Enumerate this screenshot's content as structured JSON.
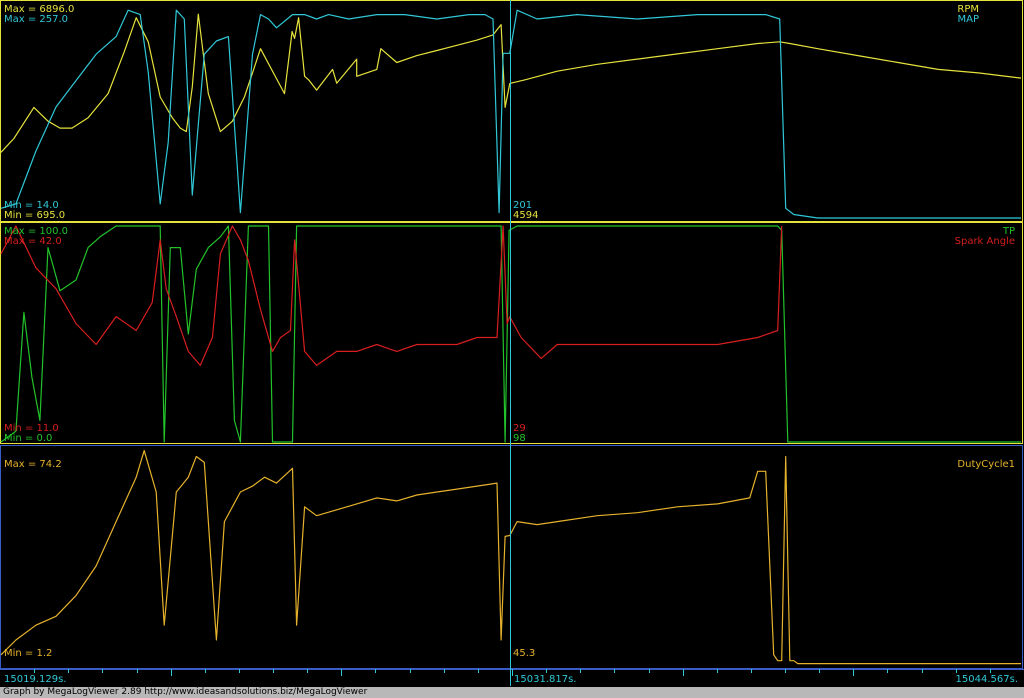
{
  "colors": {
    "rpm": "#e6e23c",
    "map": "#30c8d8",
    "tp": "#22c22a",
    "spark": "#d81e1e",
    "duty": "#e6b22c",
    "cursor": "#30c8d8"
  },
  "cursor": {
    "time": "15031.817s."
  },
  "time_axis": {
    "start": "15019.129s.",
    "end": "15044.567s."
  },
  "footer": {
    "text": "Graph by MegaLogViewer 2.89 http://www.ideasandsolutions.biz/MegaLogViewer"
  },
  "panels": {
    "p1": {
      "names": [
        "RPM",
        "MAP"
      ],
      "max": [
        "Max = 6896.0",
        "Max = 257.0"
      ],
      "min": [
        "Min = 14.0",
        "Min = 695.0"
      ],
      "cursor_values": [
        "201",
        "4594"
      ]
    },
    "p2": {
      "names": [
        "TP",
        "Spark Angle"
      ],
      "max": [
        "Max = 100.0",
        "Max = 42.0"
      ],
      "min": [
        "Min = 11.0",
        "Min = 0.0"
      ],
      "cursor_values": [
        "29",
        "98"
      ]
    },
    "p3": {
      "names": [
        "DutyCycle1"
      ],
      "max": [
        "Max = 74.2"
      ],
      "min": [
        "Min = 1.2"
      ],
      "cursor_values": [
        "45.3"
      ]
    }
  },
  "chart_data": [
    {
      "type": "line",
      "x_unit": "s",
      "xlim": [
        15019.129,
        15044.567
      ],
      "series": [
        {
          "name": "RPM",
          "ylim": [
            695.0,
            6896.0
          ],
          "x": [
            15019.129,
            15019.45,
            15019.95,
            15020.3,
            15020.6,
            15020.9,
            15021.3,
            15021.8,
            15022.2,
            15022.5,
            15022.8,
            15023.1,
            15023.4,
            15023.6,
            15023.75,
            15023.9,
            15024.05,
            15024.3,
            15024.6,
            15024.9,
            15025.2,
            15025.4,
            15025.6,
            15026.2,
            15026.8,
            15027.4,
            15028.0,
            15028.6,
            15026.39,
            15026.45,
            15026.55,
            15026.7,
            15027.0,
            15027.5,
            15028.0,
            15028.5,
            15029.0,
            15029.5,
            15030.0,
            15030.5,
            15031.0,
            15031.4,
            15031.6,
            15031.7,
            15031.817,
            15032.2,
            15033.0,
            15034.0,
            15035.0,
            15036.0,
            15037.0,
            15038.0,
            15038.55,
            15038.8,
            15039.5,
            15040.5,
            15041.5,
            15042.5,
            15043.5,
            15044.567
          ],
          "y": [
            2600,
            3000,
            3900,
            3500,
            3300,
            3300,
            3600,
            4300,
            5500,
            6500,
            5800,
            4200,
            3600,
            3300,
            3200,
            4500,
            6600,
            4300,
            3200,
            3500,
            4200,
            4900,
            5600,
            4300,
            4700,
            5000,
            5300,
            5600,
            6100,
            5900,
            6500,
            4800,
            4400,
            4600,
            4800,
            5000,
            5200,
            5400,
            5550,
            5700,
            5850,
            6000,
            6300,
            3900,
            4594,
            4700,
            4950,
            5150,
            5300,
            5450,
            5600,
            5750,
            5800,
            5750,
            5600,
            5400,
            5200,
            5000,
            4900,
            4750
          ]
        },
        {
          "name": "MAP",
          "ylim": [
            14.0,
            257.0
          ],
          "x": [
            15019.129,
            15019.5,
            15020.0,
            15020.5,
            15021.0,
            15021.5,
            15022.0,
            15022.3,
            15022.6,
            15022.8,
            15023.1,
            15023.3,
            15023.5,
            15023.7,
            15023.9,
            15024.2,
            15024.5,
            15024.8,
            15025.1,
            15025.4,
            15025.6,
            15025.8,
            15026.0,
            15026.4,
            15026.7,
            15027.0,
            15027.3,
            15027.8,
            15028.5,
            15029.2,
            15030.0,
            15030.8,
            15031.2,
            15031.4,
            15031.55,
            15031.65,
            15031.817,
            15032.0,
            15032.5,
            15033.5,
            15035.0,
            15036.5,
            15037.5,
            15038.2,
            15038.55,
            15038.7,
            15038.9,
            15039.5,
            15044.567
          ],
          "y": [
            25,
            30,
            90,
            140,
            170,
            200,
            220,
            250,
            245,
            180,
            30,
            100,
            250,
            240,
            40,
            200,
            215,
            220,
            20,
            200,
            245,
            240,
            230,
            245,
            245,
            240,
            245,
            240,
            245,
            245,
            240,
            245,
            245,
            240,
            20,
            201,
            201,
            250,
            240,
            245,
            240,
            245,
            245,
            245,
            240,
            25,
            18,
            14,
            14
          ]
        }
      ]
    },
    {
      "type": "line",
      "x_unit": "s",
      "xlim": [
        15019.129,
        15044.567
      ],
      "series": [
        {
          "name": "TP",
          "ylim": [
            0.0,
            100.0
          ],
          "x": [
            15019.129,
            15019.5,
            15019.7,
            15019.9,
            15020.1,
            15020.3,
            15020.6,
            15021.0,
            15021.3,
            15021.6,
            15022.0,
            15022.4,
            15022.8,
            15023.1,
            15023.2,
            15023.35,
            15023.6,
            15023.8,
            15024.0,
            15024.3,
            15024.6,
            15024.8,
            15024.95,
            15025.1,
            15025.3,
            15025.6,
            15025.8,
            15025.9,
            15026.4,
            15026.5,
            15026.7,
            15027.0,
            15028.0,
            15029.0,
            15030.0,
            15031.0,
            15031.6,
            15031.7,
            15031.8,
            15032.0,
            15033.0,
            15034.0,
            15035.0,
            15036.0,
            15037.0,
            15038.0,
            15038.5,
            15038.6,
            15038.75,
            15044.567
          ],
          "y": [
            0,
            5,
            60,
            30,
            10,
            90,
            70,
            75,
            90,
            95,
            100,
            100,
            100,
            100,
            0,
            90,
            90,
            50,
            80,
            90,
            95,
            100,
            10,
            0,
            100,
            100,
            100,
            0,
            0,
            100,
            100,
            100,
            100,
            100,
            100,
            100,
            100,
            0,
            98,
            100,
            100,
            100,
            100,
            100,
            100,
            100,
            100,
            98,
            0,
            0
          ]
        },
        {
          "name": "Spark Angle",
          "ylim": [
            11.0,
            42.0
          ],
          "x": [
            15019.129,
            15019.5,
            15020.0,
            15020.5,
            15021.0,
            15021.5,
            15022.0,
            15022.5,
            15022.9,
            15023.1,
            15023.25,
            15023.5,
            15023.8,
            15024.1,
            15024.4,
            15024.6,
            15024.9,
            15025.1,
            15025.3,
            15025.6,
            15025.9,
            15026.1,
            15026.35,
            15026.45,
            15026.7,
            15027.0,
            15027.5,
            15028.0,
            15028.5,
            15029.0,
            15029.5,
            15030.0,
            15030.5,
            15031.0,
            15031.5,
            15031.65,
            15031.75,
            15031.817,
            15032.1,
            15032.6,
            15033.0,
            15034.0,
            15035.0,
            15036.0,
            15037.0,
            15038.0,
            15038.5,
            15038.6
          ],
          "y": [
            38,
            42,
            36,
            33,
            28,
            25,
            29,
            27,
            31,
            40,
            33,
            29,
            24,
            22,
            26,
            38,
            42,
            40,
            37,
            30,
            24,
            26,
            27,
            40,
            24,
            22,
            24,
            24,
            25,
            24,
            25,
            25,
            25,
            26,
            26,
            42,
            28,
            29,
            26,
            23,
            25,
            25,
            25,
            25,
            25,
            26,
            27,
            42
          ]
        }
      ]
    },
    {
      "type": "line",
      "x_unit": "s",
      "xlim": [
        15019.129,
        15044.567
      ],
      "series": [
        {
          "name": "DutyCycle1",
          "ylim": [
            1.2,
            74.2
          ],
          "x": [
            15019.129,
            15019.5,
            15020.0,
            15020.5,
            15021.0,
            15021.5,
            15022.0,
            15022.5,
            15022.7,
            15023.0,
            15023.2,
            15023.5,
            15023.8,
            15024.0,
            15024.2,
            15024.5,
            15024.7,
            15024.9,
            15025.1,
            15025.4,
            15025.7,
            15026.0,
            15026.4,
            15026.5,
            15026.7,
            15027.0,
            15027.5,
            15028.0,
            15028.5,
            15029.0,
            15029.5,
            15030.0,
            15030.5,
            15031.0,
            15031.5,
            15031.6,
            15031.7,
            15031.817,
            15032.0,
            15032.5,
            15033.0,
            15034.0,
            15035.0,
            15036.0,
            15037.0,
            15037.8,
            15038.0,
            15038.2,
            15038.4,
            15038.5,
            15038.6,
            15038.7,
            15038.8,
            15038.9,
            15039.0,
            15040.0,
            15041.0,
            15042.0,
            15043.0,
            15044.567
          ],
          "y": [
            5,
            10,
            15,
            18,
            25,
            35,
            50,
            65,
            74,
            60,
            15,
            60,
            65,
            72,
            70,
            10,
            50,
            55,
            60,
            62,
            65,
            63,
            68,
            15,
            55,
            52,
            54,
            56,
            58,
            57,
            59,
            60,
            61,
            62,
            63,
            10,
            45,
            45.3,
            50,
            49,
            50,
            52,
            53,
            55,
            56,
            58,
            67,
            67,
            5,
            3,
            3,
            72,
            3,
            3,
            2,
            2,
            2,
            2,
            2,
            2
          ]
        }
      ]
    }
  ]
}
